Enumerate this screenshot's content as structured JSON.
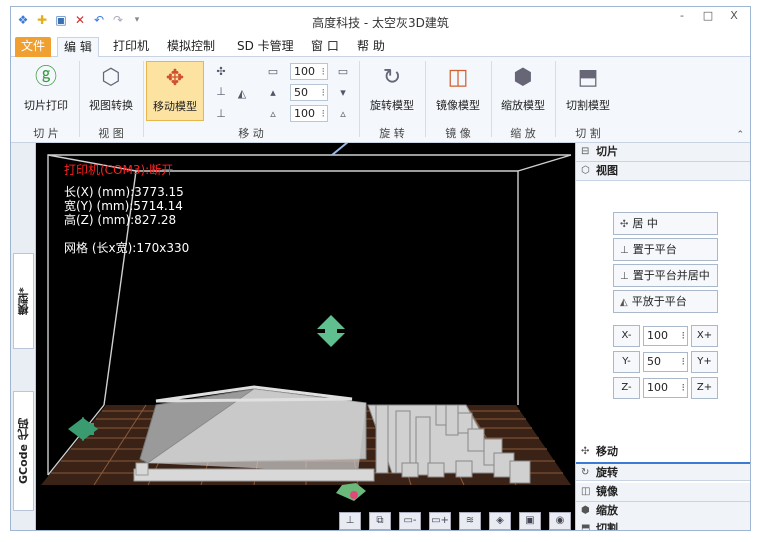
{
  "window": {
    "title": "高度科技 - 太空灰3D建筑",
    "quick_icons": [
      "app-icon",
      "new-icon",
      "save-icon",
      "delete-icon",
      "undo-icon",
      "redo-icon",
      "dropdown-icon"
    ],
    "controls": {
      "minimize": "-",
      "maximize": "□",
      "close": "X"
    }
  },
  "menu": {
    "file": "文件",
    "tabs": [
      "编 辑",
      "打印机",
      "模拟控制",
      "SD 卡管理",
      "窗 口",
      "帮 助"
    ]
  },
  "ribbon": {
    "slice_print": "切片打印",
    "view_convert": "视图转换",
    "move_model": "移动模型",
    "rotate_model": "旋转模型",
    "mirror_model": "镜像模型",
    "scale_model": "缩放模型",
    "cut_model": "切割模型",
    "spin_values": [
      "100",
      "50",
      "100"
    ],
    "groups": [
      "切 片",
      "视 图",
      "移 动",
      "旋 转",
      "镜 像",
      "缩 放",
      "切 割"
    ]
  },
  "viewport": {
    "status": "打印机(COM3):断开",
    "length": "长(X) (mm):3773.15",
    "width": "宽(Y) (mm):5714.14",
    "height": "高(Z) (mm):827.28",
    "grid": "网格 (长x宽):170x330",
    "colors": {
      "background": "#000000",
      "bed": "#3a2216",
      "grid_line": "#8a5a3a",
      "frame": "#cfcfcf",
      "model": "#cfcfcf",
      "status": "#ff2020"
    }
  },
  "left_tabs": {
    "model": "模型*",
    "gcode": "GCode 代码"
  },
  "right_panel": {
    "sections_top": [
      "切片",
      "视图"
    ],
    "buttons": [
      "居 中",
      "置于平台",
      "置于平台并居中",
      "平放于平台"
    ],
    "axes": [
      {
        "minus": "X-",
        "value": "100",
        "plus": "X+"
      },
      {
        "minus": "Y-",
        "value": "50",
        "plus": "Y+"
      },
      {
        "minus": "Z-",
        "value": "100",
        "plus": "Z+"
      }
    ],
    "sections_bottom": [
      "移动",
      "旋转",
      "镜像",
      "缩放",
      "切割"
    ]
  }
}
